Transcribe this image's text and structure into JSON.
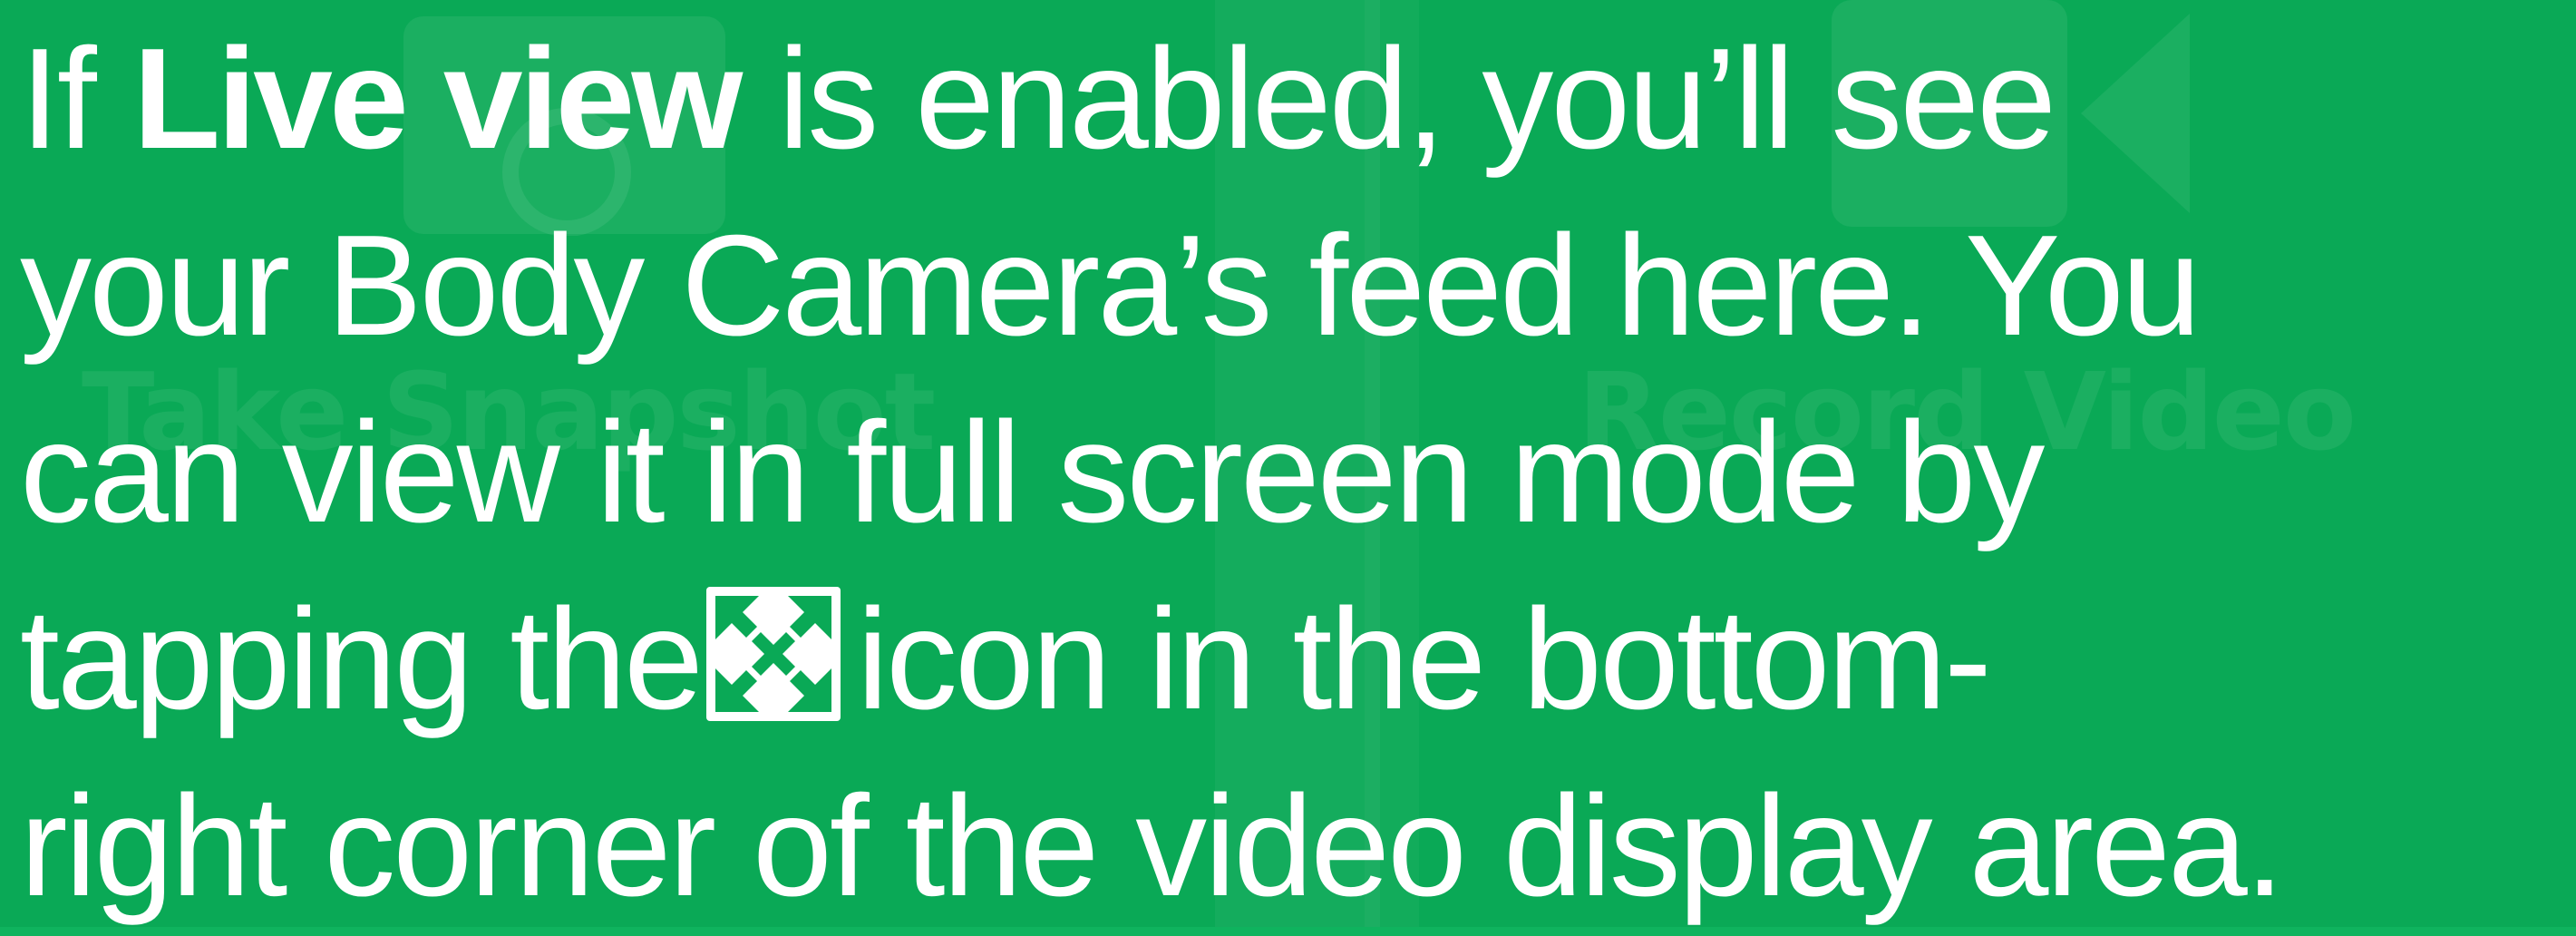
{
  "background": {
    "snapshot_label": "Take Snapshot",
    "record_label": "Record Video",
    "snapshot_icon": "camera-icon",
    "record_icon": "video-camera-icon"
  },
  "overlay": {
    "line1_prefix": "If ",
    "line1_bold": "Live view",
    "line1_suffix": " is enabled, you’ll see",
    "line2": "your Body Camera’s feed here. You",
    "line3": "can view it in full screen mode by",
    "line4_prefix": "tapping the",
    "line4_icon": "fullscreen-expand-icon",
    "line4_suffix": "icon in the bottom-",
    "line5": "right corner of the video display area."
  },
  "colors": {
    "background": "#0aa956",
    "text": "#ffffff"
  }
}
